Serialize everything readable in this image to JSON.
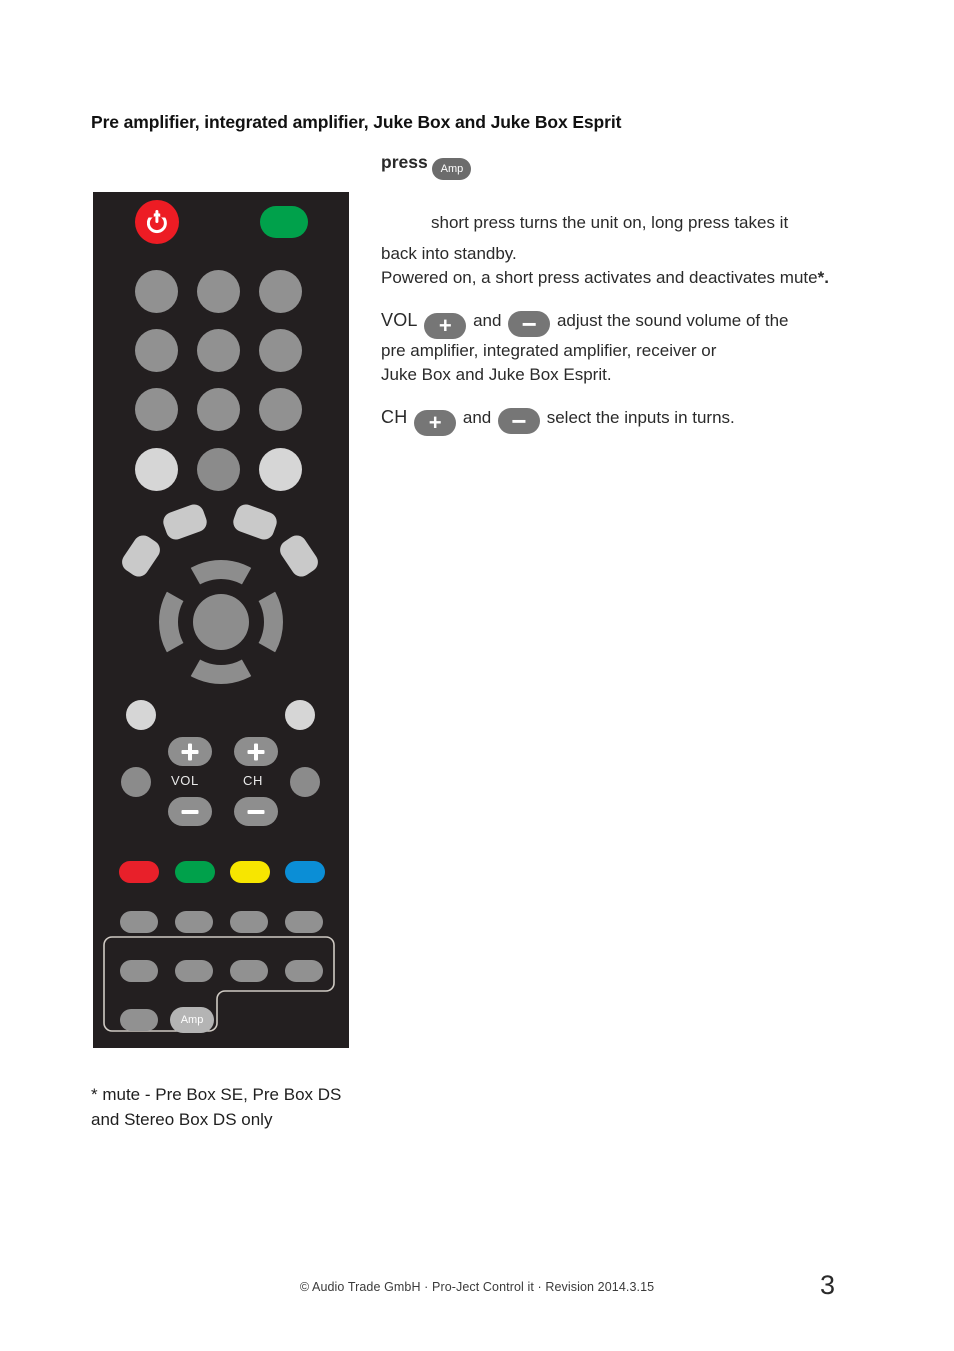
{
  "document": {
    "heading": "Pre amplifier, integrated amplifier, Juke Box and Juke Box Esprit",
    "footnote_line1": "* mute - Pre Box SE, Pre Box DS",
    "footnote_line2": "and Stereo Box DS only",
    "footer_text": "© Audio Trade GmbH · Pro-Ject Control it · Revision 2014.3.15",
    "page_number": "3"
  },
  "instructions": {
    "press_label": "press",
    "amp_badge": "Amp",
    "power_line1": "short press turns the unit on, long press takes it",
    "power_line2": "back into standby.",
    "power_line3": "Powered on, a short press activates and deactivates mute",
    "power_line3_asterisk": "*.",
    "vol_label": "VOL",
    "vol_and": "and",
    "vol_line1": "adjust the sound volume of the",
    "vol_line2": "pre amplifier, integrated amplifier, receiver or",
    "vol_line3": "Juke Box and Juke Box Esprit.",
    "ch_label": "CH",
    "ch_and": "and",
    "ch_line1": "select the inputs in turns.",
    "plus_symbol": "+",
    "minus_symbol": "−"
  },
  "remote": {
    "vol_label": "VOL",
    "ch_label": "CH",
    "amp_label": "Amp",
    "colors": {
      "body": "#231f20",
      "power": "#ed1c24",
      "green": "#00a14b",
      "red_color_key": "#e8202a",
      "green_color_key": "#00a14b",
      "yellow_color_key": "#f7e600",
      "blue_color_key": "#0b8ed6",
      "gray_button": "#919191",
      "light_button": "#d6d6d6",
      "mid_button": "#8b8b8b",
      "dpad": "#8d8d8d",
      "petal": "#c9c9c9",
      "highlight_outline": "#cfcac3"
    },
    "keypad_rows": [
      [
        "key-1",
        "key-2",
        "key-3"
      ],
      [
        "key-4",
        "key-5",
        "key-6"
      ],
      [
        "key-7",
        "key-8",
        "key-9"
      ],
      [
        "key-light-left",
        "key-0",
        "key-light-right"
      ]
    ],
    "color_keys": [
      "red",
      "green",
      "yellow",
      "blue"
    ],
    "bottom_rows": [
      [
        "fn-a1",
        "fn-a2",
        "fn-a3",
        "fn-a4"
      ],
      [
        "fn-b1",
        "fn-b2",
        "fn-b3",
        "fn-b4"
      ],
      [
        "fn-c1",
        "amp"
      ]
    ]
  }
}
